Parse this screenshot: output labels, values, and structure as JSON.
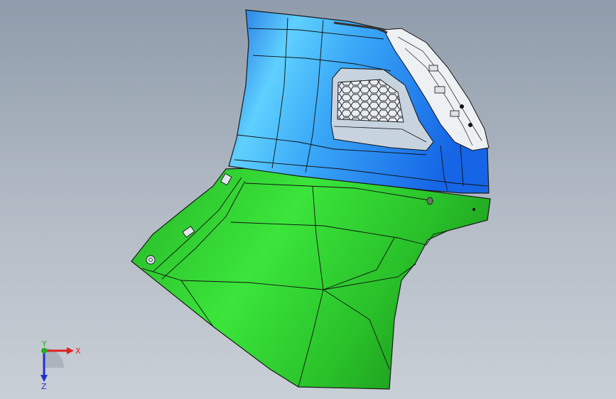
{
  "viewport": {
    "background_top": "#8f9cab",
    "background_bottom": "#c9cfd6"
  },
  "model": {
    "upper_part_color": "#2f8df0",
    "lower_part_color": "#2fd12f",
    "edge_color": "#1a1a1a"
  },
  "triad": {
    "x_label": "X",
    "y_label": "Y",
    "z_label": "Z",
    "x_color": "#e02020",
    "y_color": "#20b020",
    "z_color": "#2030d0"
  }
}
